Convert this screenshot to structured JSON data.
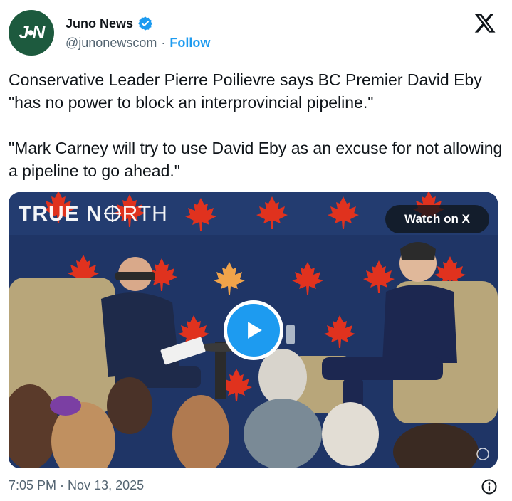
{
  "author": {
    "avatar_text": "J•N",
    "name": "Juno News",
    "handle": "@junonewscom",
    "separator": "·",
    "follow_label": "Follow"
  },
  "tweet": {
    "paragraph_1": "Conservative Leader Pierre Poilievre says BC Premier David Eby \"has no power to block an interprovincial pipeline.\"",
    "paragraph_2": "\"Mark Carney will try to use David Eby as an excuse for not allowing a pipeline to go ahead.\""
  },
  "media": {
    "watermark_bold": "TRUE N",
    "watermark_light": "RTH",
    "watch_label": "Watch on X"
  },
  "footer": {
    "timestamp": "7:05 PM · Nov 13, 2025"
  },
  "colors": {
    "accent": "#1d9bf0",
    "avatar_bg": "#1d5a3e",
    "backdrop": "#1f3566",
    "maple_leaf": "#e0321e"
  },
  "icons": {
    "verified": "verified-badge-icon",
    "x": "x-logo-icon",
    "play": "play-icon",
    "info": "info-icon",
    "compass": "compass-icon"
  }
}
